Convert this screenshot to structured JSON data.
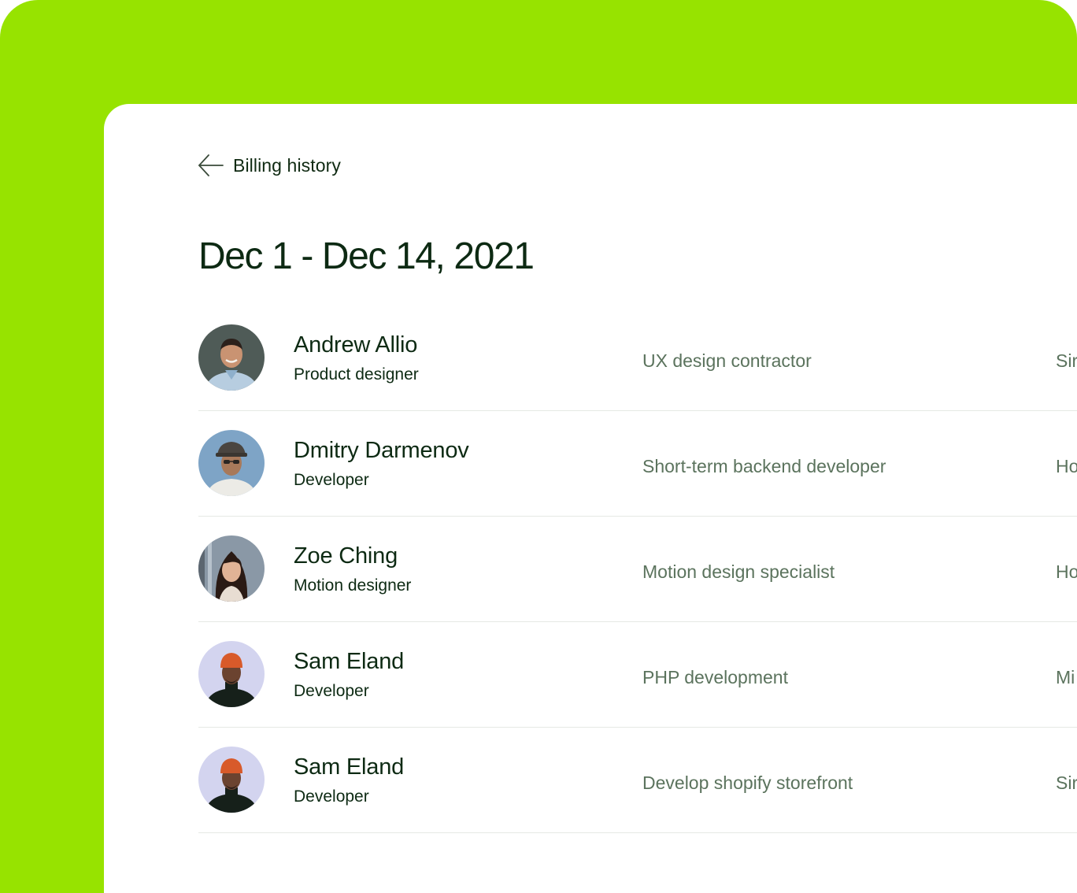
{
  "nav": {
    "back_label": "Billing history"
  },
  "header": {
    "title": "Dec 1 - Dec 14, 2021"
  },
  "rows": [
    {
      "name": "Andrew Allio",
      "role": "Product designer",
      "project": "UX design contractor",
      "extra": "Sir"
    },
    {
      "name": "Dmitry Darmenov",
      "role": "Developer",
      "project": "Short-term backend developer",
      "extra": "Ho"
    },
    {
      "name": "Zoe Ching",
      "role": "Motion designer",
      "project": "Motion design specialist",
      "extra": "Ho"
    },
    {
      "name": "Sam Eland",
      "role": "Developer",
      "project": "PHP development",
      "extra": "Mi"
    },
    {
      "name": "Sam Eland",
      "role": "Developer",
      "project": "Develop shopify storefront",
      "extra": "Sir"
    }
  ],
  "colors": {
    "accent_green": "#97e300",
    "text_dark": "#0d2a13",
    "text_muted": "#5b735d"
  }
}
